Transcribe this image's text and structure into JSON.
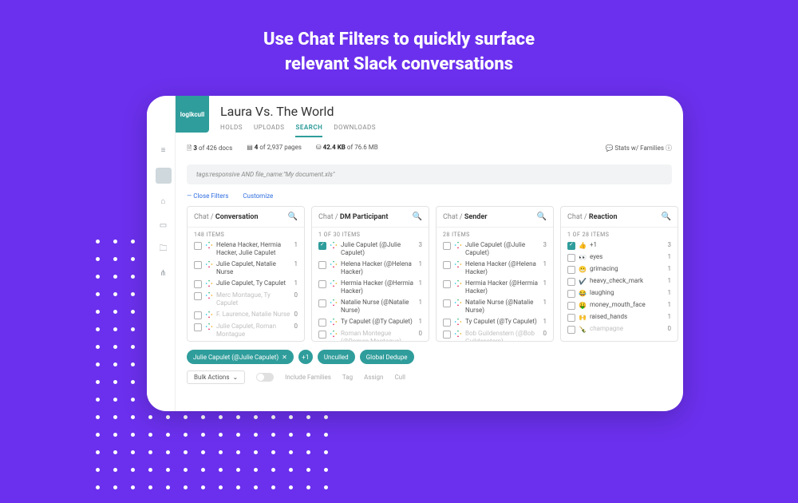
{
  "hero": {
    "line1": "Use Chat Filters to quickly surface",
    "line2": "relevant Slack conversations"
  },
  "brand": "logikcull",
  "title": "Laura Vs. The World",
  "tabs": [
    "HOLDS",
    "UPLOADS",
    "SEARCH",
    "DOWNLOADS"
  ],
  "active_tab_index": 2,
  "stats": {
    "docs": {
      "n": "3",
      "of": "426",
      "label": "docs"
    },
    "pages": {
      "n": "4",
      "of": "2,937",
      "label": "pages"
    },
    "size": {
      "n": "42.4 KB",
      "of": "76.6 MB"
    },
    "right": "Stats w/ Families"
  },
  "search_query": "tags:responsive AND file_name:\"My document.xls\"",
  "filter_actions": {
    "close": "Close Filters",
    "customize": "Customize"
  },
  "facets": [
    {
      "group": "Chat",
      "name": "Conversation",
      "subtitle": "148 ITEMS",
      "items": [
        {
          "checked": false,
          "icon": "slack",
          "label": "Helena Hacker, Hermia Hacker, Julie Capulet",
          "count": 1
        },
        {
          "checked": false,
          "icon": "slack",
          "label": "Julie Capulet, Natalie Nurse",
          "count": 1
        },
        {
          "checked": false,
          "icon": "slack",
          "label": "Julie Capulet, Ty Capulet",
          "count": 1
        },
        {
          "checked": false,
          "icon": "slack",
          "label": "Merc Montague, Ty Capulet",
          "count": 0,
          "dim": true
        },
        {
          "checked": false,
          "icon": "slack",
          "label": "F. Laurence, Natalie Nurse",
          "count": 0,
          "dim": true
        },
        {
          "checked": false,
          "icon": "slack",
          "label": "Julie Capulet, Roman Montague",
          "count": 0,
          "dim": true
        }
      ]
    },
    {
      "group": "Chat",
      "name": "DM Participant",
      "subtitle": "1 OF 30 ITEMS",
      "items": [
        {
          "checked": true,
          "icon": "slack",
          "label": "Julie Capulet (@Julie Capulet)",
          "count": 3
        },
        {
          "checked": false,
          "icon": "slack",
          "label": "Helena Hacker (@Helena Hacker)",
          "count": 1
        },
        {
          "checked": false,
          "icon": "slack",
          "label": "Hermia Hacker (@Hermia Hacker)",
          "count": 1
        },
        {
          "checked": false,
          "icon": "slack",
          "label": "Natalie Nurse (@Natalie Nurse)",
          "count": 1
        },
        {
          "checked": false,
          "icon": "slack",
          "label": "Ty Capulet (@Ty Capulet)",
          "count": 1
        },
        {
          "checked": false,
          "icon": "slack",
          "label": "Roman Montegue (@Roman Montague)",
          "count": 0,
          "dim": true
        }
      ]
    },
    {
      "group": "Chat",
      "name": "Sender",
      "subtitle": "28 ITEMS",
      "items": [
        {
          "checked": false,
          "icon": "slack",
          "label": "Julie Capulet (@Julie Capulet)",
          "count": 3
        },
        {
          "checked": false,
          "icon": "slack",
          "label": "Helena Hacker (@Helena Hacker)",
          "count": 1
        },
        {
          "checked": false,
          "icon": "slack",
          "label": "Hermia Hacker (@Hermia Hacker)",
          "count": 1
        },
        {
          "checked": false,
          "icon": "slack",
          "label": "Natalie Nurse (@Natalie Nurse)",
          "count": 1
        },
        {
          "checked": false,
          "icon": "slack",
          "label": "Ty Capulet (@Ty Capulet)",
          "count": 1
        },
        {
          "checked": false,
          "icon": "slack",
          "label": "Bob Guildenstern (@Bob Guildenstern)",
          "count": 0,
          "dim": true
        }
      ]
    },
    {
      "group": "Chat",
      "name": "Reaction",
      "subtitle": "1 OF 28 ITEMS",
      "items": [
        {
          "checked": true,
          "icon": "emoji",
          "emoji": "👍",
          "label": "+1",
          "count": 3
        },
        {
          "checked": false,
          "icon": "emoji",
          "emoji": "👀",
          "label": "eyes",
          "count": 1
        },
        {
          "checked": false,
          "icon": "emoji",
          "emoji": "😬",
          "label": "grimacing",
          "count": 1
        },
        {
          "checked": false,
          "icon": "emoji",
          "emoji": "✔️",
          "label": "heavy_check_mark",
          "count": 1
        },
        {
          "checked": false,
          "icon": "emoji",
          "emoji": "😂",
          "label": "laughing",
          "count": 1
        },
        {
          "checked": false,
          "icon": "emoji",
          "emoji": "🤑",
          "label": "money_mouth_face",
          "count": 1
        },
        {
          "checked": false,
          "icon": "emoji",
          "emoji": "🙌",
          "label": "raised_hands",
          "count": 1
        },
        {
          "checked": false,
          "icon": "emoji",
          "emoji": "🍾",
          "label": "champagne",
          "count": 0,
          "dim": true
        }
      ]
    }
  ],
  "pills": [
    "Julie Capulet (@Julie Capulet)",
    "+1",
    "Unculled",
    "Global Dedupe"
  ],
  "bulk": {
    "button": "Bulk Actions",
    "include_families": "Include Families",
    "actions": [
      "Tag",
      "Assign",
      "Cull"
    ]
  }
}
